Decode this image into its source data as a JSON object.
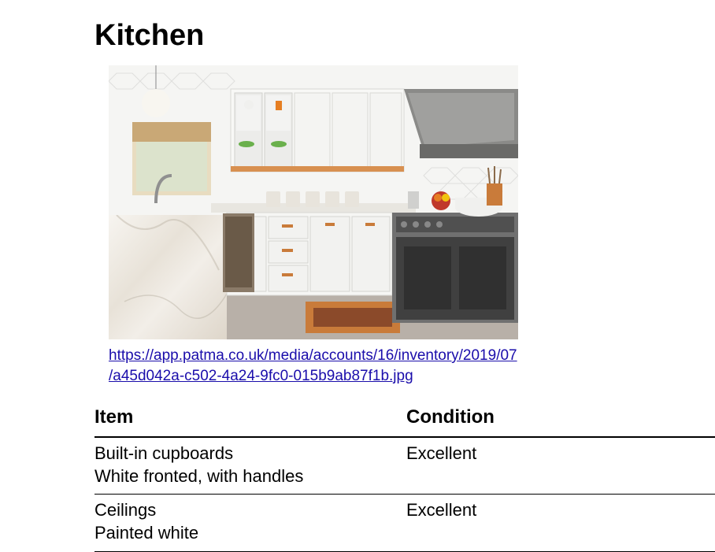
{
  "page_title": "Kitchen",
  "image": {
    "link_text": "https://app.patma.co.uk/media/accounts/16/inventory/2019/07/a45d042a-c502-4a24-9fc0-015b9ab87f1b.jpg"
  },
  "table": {
    "headers": {
      "item": "Item",
      "condition": "Condition"
    },
    "rows": [
      {
        "name": "Built-in cupboards",
        "description": "White fronted, with handles",
        "condition": "Excellent"
      },
      {
        "name": "Ceilings",
        "description": "Painted white",
        "condition": "Excellent"
      }
    ]
  }
}
